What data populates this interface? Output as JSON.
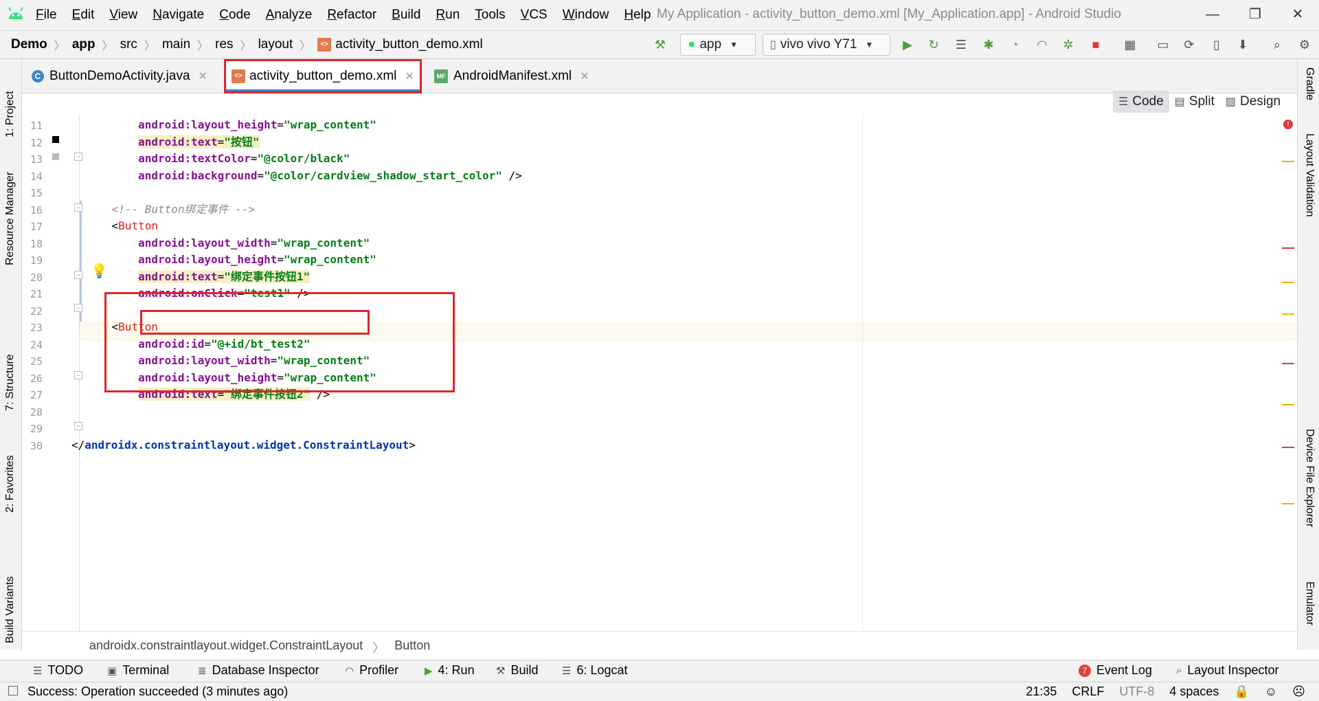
{
  "menubar": {
    "items": [
      "File",
      "Edit",
      "View",
      "Navigate",
      "Code",
      "Analyze",
      "Refactor",
      "Build",
      "Run",
      "Tools",
      "VCS",
      "Window",
      "Help"
    ],
    "window_title": "My Application - activity_button_demo.xml [My_Application.app] - Android Studio",
    "minimize": "—",
    "restore": "❐",
    "close": "✕"
  },
  "breadcrumbs": [
    "Demo",
    "app",
    "src",
    "main",
    "res",
    "layout",
    "activity_button_demo.xml"
  ],
  "toolbar": {
    "run_config": "app",
    "device": "vivo vivo Y71"
  },
  "tabs": [
    {
      "label": "ButtonDemoActivity.java",
      "icon": "java-class-icon",
      "active": false
    },
    {
      "label": "activity_button_demo.xml",
      "icon": "xml-file-icon",
      "active": true
    },
    {
      "label": "AndroidManifest.xml",
      "icon": "manifest-file-icon",
      "active": false
    }
  ],
  "view_modes": {
    "code": "Code",
    "split": "Split",
    "design": "Design",
    "selected": "Code"
  },
  "left_tools": [
    "1: Project",
    "Resource Manager",
    "7: Structure",
    "2: Favorites",
    "Build Variants"
  ],
  "right_tools": [
    "Gradle",
    "Layout Validation",
    "Device File Explorer",
    "Emulator"
  ],
  "code": {
    "lines": [
      {
        "n": "11",
        "indent": "        ",
        "attr": "android:layout_height",
        "eq": "=",
        "val": "\"wrap_content\"",
        "end": ""
      },
      {
        "n": "12",
        "indent": "        ",
        "attr": "android:text",
        "eq": "=",
        "val": "\"按钮\"",
        "end": ""
      },
      {
        "n": "13",
        "indent": "        ",
        "attr": "android:textColor",
        "eq": "=",
        "val": "\"@color/black\"",
        "end": ""
      },
      {
        "n": "14",
        "indent": "        ",
        "attr": "android:background",
        "eq": "=",
        "val": "\"@color/cardview_shadow_start_color\"",
        "end": " />"
      },
      {
        "n": "15"
      },
      {
        "n": "16",
        "comment": "    <!-- Button绑定事件 -->"
      },
      {
        "n": "17",
        "open": "<",
        "tag": "Button"
      },
      {
        "n": "18",
        "indent": "        ",
        "attr": "android:layout_width",
        "eq": "=",
        "val": "\"wrap_content\"",
        "end": ""
      },
      {
        "n": "19",
        "indent": "        ",
        "attr": "android:layout_height",
        "eq": "=",
        "val": "\"wrap_content\"",
        "end": ""
      },
      {
        "n": "20",
        "indent": "        ",
        "attr": "android:text",
        "eq": "=",
        "val": "\"绑定事件按钮1\"",
        "end": ""
      },
      {
        "n": "21",
        "indent": "        ",
        "attr": "android:onClick",
        "eq": "=",
        "val": "\"test1\"",
        "end": " />"
      },
      {
        "n": "22"
      },
      {
        "n": "23",
        "open": "<",
        "tag": "Button"
      },
      {
        "n": "24",
        "indent": "        ",
        "attr": "android:id",
        "eq": "=",
        "val": "\"@+id/bt_test2\"",
        "end": ""
      },
      {
        "n": "25",
        "indent": "        ",
        "attr": "android:layout_width",
        "eq": "=",
        "val": "\"wrap_content\"",
        "end": ""
      },
      {
        "n": "26",
        "indent": "        ",
        "attr": "android:layout_height",
        "eq": "=",
        "val": "\"wrap_content\"",
        "end": ""
      },
      {
        "n": "27",
        "indent": "        ",
        "attr": "android:text",
        "eq": "=",
        "val": "\"绑定事件按钮2\"",
        "end": " />"
      },
      {
        "n": "28"
      },
      {
        "n": "29"
      },
      {
        "n": "30",
        "close_open": "</",
        "close_tag": "androidx.constraintlayout.widget.ConstraintLayout",
        "close_end": ">"
      }
    ]
  },
  "editor_breadcrumb": [
    "androidx.constraintlayout.widget.ConstraintLayout",
    "Button"
  ],
  "tool_windows": {
    "todo": "TODO",
    "terminal": "Terminal",
    "database": "Database Inspector",
    "profiler": "Profiler",
    "run": "4: Run",
    "build": "Build",
    "logcat": "6: Logcat",
    "event_log": "Event Log",
    "event_log_count": "7",
    "layout_inspector": "Layout Inspector"
  },
  "status": {
    "message": "Success: Operation succeeded (3 minutes ago)",
    "position": "21:35",
    "line_sep": "CRLF",
    "encoding": "UTF-8",
    "indent": "4 spaces"
  },
  "colors": {
    "attr": "#871094",
    "value": "#067d17",
    "tag": "#e01f1f",
    "highlight_box": "#e0242b"
  }
}
